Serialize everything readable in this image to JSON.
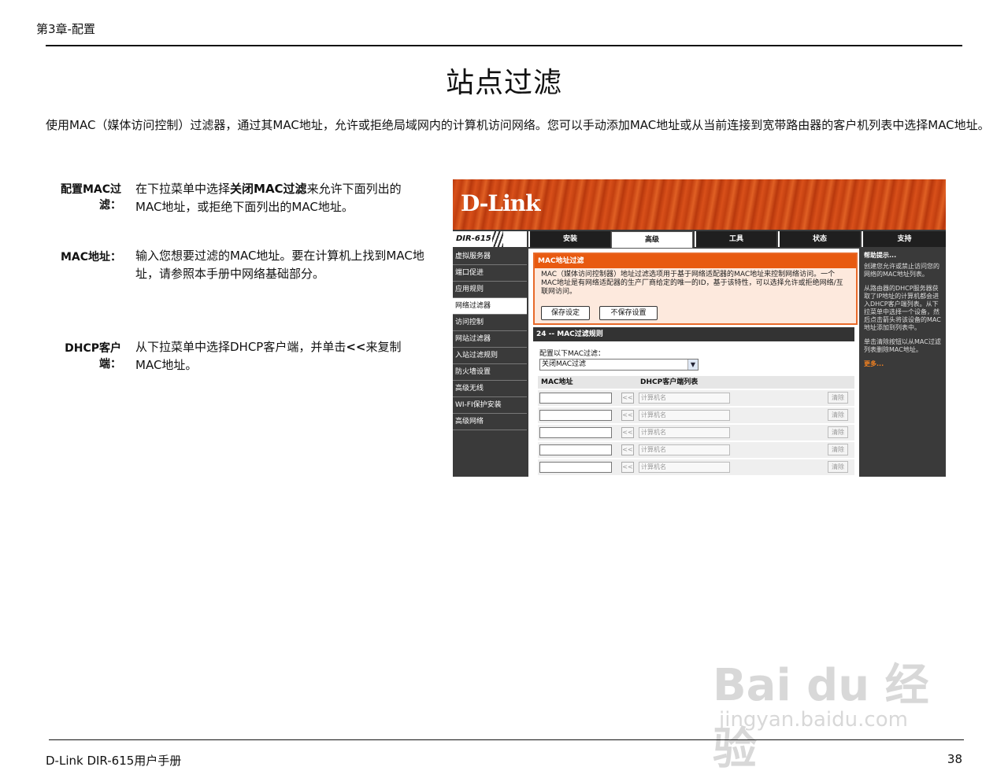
{
  "header": {
    "chapter": "第3章-配置"
  },
  "title": "站点过滤",
  "intro": "使用MAC（媒体访问控制）过滤器，通过其MAC地址，允许或拒绝局域网内的计算机访问网络。您可以手动添加MAC地址或从当前连接到宽带路由器的客户机列表中选择MAC地址。",
  "items": [
    {
      "label": "配置MAC过滤：",
      "pre": "在下拉菜单中选择",
      "bold": "关闭MAC过滤",
      "post": "来允许下面列出的MAC地址，或拒绝下面列出的MAC地址。"
    },
    {
      "label": "MAC地址：",
      "text": "输入您想要过滤的MAC地址。要在计算机上找到MAC地址，请参照本手册中网络基础部分。"
    },
    {
      "label": "DHCP客户端：",
      "pre": "从下拉菜单中选择DHCP客户端，并单击",
      "bold": "<<",
      "post": "来复制MAC地址。"
    }
  ],
  "router": {
    "logo": "D-Link",
    "model": "DIR-615",
    "tabs": [
      "安装",
      "高级",
      "工具",
      "状态",
      "支持"
    ],
    "nav": [
      "虚拟服务器",
      "端口促进",
      "应用规则",
      "网络过滤器",
      "访问控制",
      "网站过滤器",
      "入站过滤规则",
      "防火墙设置",
      "高级无线",
      "WI-FI保护安装",
      "高级网络"
    ],
    "panel_title": "MAC地址过滤",
    "panel_text": "MAC（媒体访问控制器）地址过滤选项用于基于网络适配器的MAC地址来控制网络访问。一个MAC地址是有网络适配器的生产厂商给定的唯一的ID，基于该特性，可以选择允许或拒绝网络/互联网访问。",
    "save_btn": "保存设定",
    "nosave_btn": "不保存设置",
    "rules_title": "24 -- MAC过滤规则",
    "config_label": "配置以下MAC过滤：",
    "config_value": "关闭MAC过滤",
    "col_mac": "MAC地址",
    "col_dhcp": "DHCP客户端列表",
    "arrow_btn": "<<",
    "dhcp_placeholder": "计算机名",
    "clear_btn": "清除",
    "help_title": "帮助提示...",
    "help1": "创建您允许或禁止访问您的网络的MAC地址列表。",
    "help2": "从路由器的DHCP服务器获取了IP地址的计算机都会进入DHCP客户端列表。从下拉菜单中选择一个设备，然后点击箭头将该设备的MAC地址添加到列表中。",
    "help3": "单击清除按钮以从MAC过滤列表删除MAC地址。",
    "help_more": "更多..."
  },
  "watermark": {
    "brand": "Bai du 经验",
    "url": "jingyan.baidu.com"
  },
  "footer": {
    "left": "D-Link DIR-615用户手册",
    "page": "38"
  }
}
